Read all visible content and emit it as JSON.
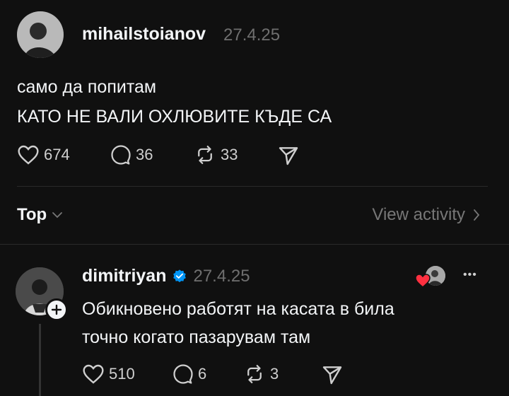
{
  "post": {
    "username": "mihailstoianov",
    "date": "27.4.25",
    "lines": [
      "само да попитам",
      "КАТО НЕ ВАЛИ  ОХЛЮВИТЕ КЪДЕ СА"
    ],
    "likes": "674",
    "comments": "36",
    "reposts": "33"
  },
  "sort": {
    "label": "Top",
    "activity_label": "View activity"
  },
  "reply": {
    "username": "dimitriyan",
    "date": "27.4.25",
    "lines": [
      "Обикновено работят на касата в била",
      "точно когато пазарувам там"
    ],
    "likes": "510",
    "comments": "6",
    "reposts": "3",
    "more_label": "•••"
  },
  "colors": {
    "background": "#101010",
    "verified": "#0095f6",
    "like_heart": "#ff3040"
  }
}
